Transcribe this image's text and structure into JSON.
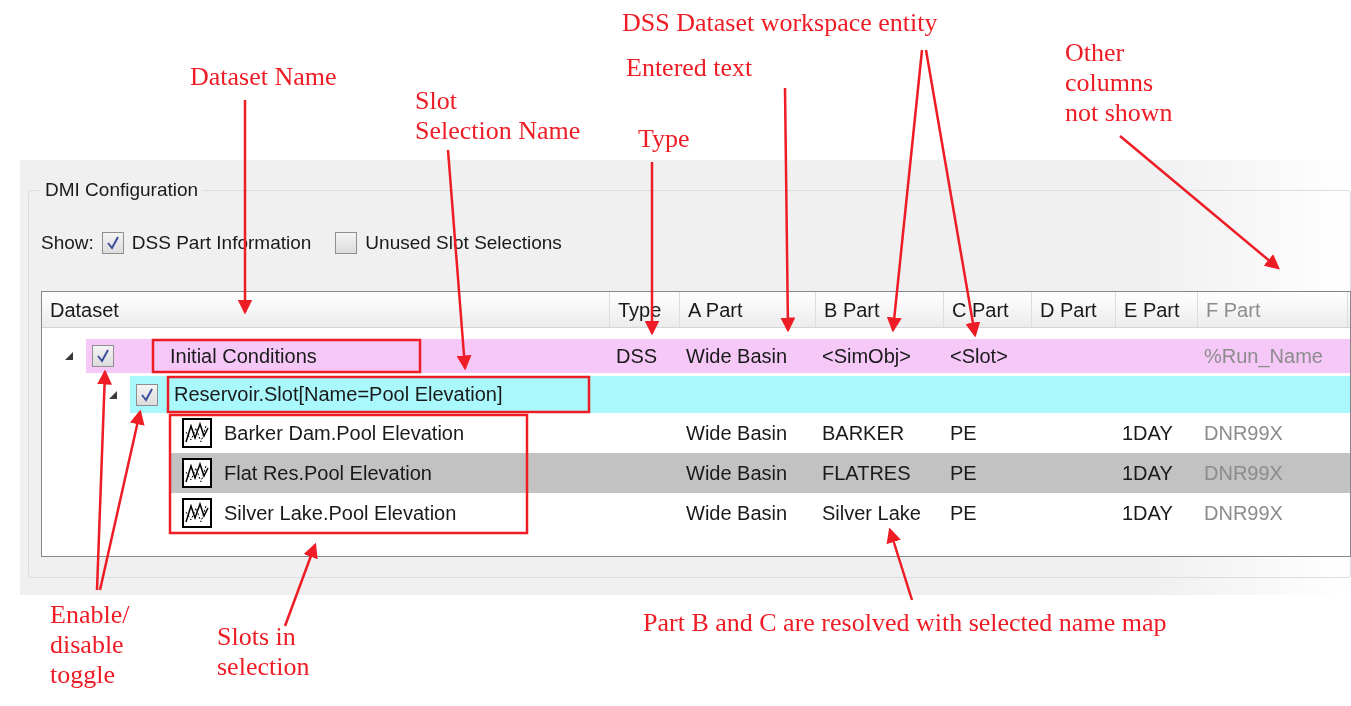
{
  "panel": {
    "title": "DMI Configuration",
    "show_label": "Show:",
    "options": [
      {
        "label": "DSS Part Information",
        "checked": true
      },
      {
        "label": "Unused Slot Selections",
        "checked": false
      }
    ]
  },
  "table": {
    "columns": [
      "Dataset",
      "Type",
      "A Part",
      "B Part",
      "C Part",
      "D Part",
      "E Part",
      "F Part"
    ],
    "rows": [
      {
        "kind": "dataset",
        "name": "Initial Conditions",
        "checked": true,
        "expanded": true,
        "cells": {
          "type": "DSS",
          "a_part": "Wide Basin",
          "b_part": "<SimObj>",
          "c_part": "<Slot>",
          "f_part": "%Run_Name"
        },
        "children": [
          {
            "kind": "selection",
            "name": "Reservoir.Slot[Name=Pool Elevation]",
            "checked": true,
            "expanded": true,
            "children": [
              {
                "kind": "slot",
                "name": "Barker Dam.Pool Elevation",
                "selected": false,
                "cells": {
                  "a_part": "Wide Basin",
                  "b_part": "BARKER",
                  "c_part": "PE",
                  "e_part": "1DAY",
                  "f_part": "DNR99X"
                }
              },
              {
                "kind": "slot",
                "name": "Flat Res.Pool Elevation",
                "selected": true,
                "cells": {
                  "a_part": "Wide Basin",
                  "b_part": "FLATRES",
                  "c_part": "PE",
                  "e_part": "1DAY",
                  "f_part": "DNR99X"
                }
              },
              {
                "kind": "slot",
                "name": "Silver Lake.Pool Elevation",
                "selected": false,
                "cells": {
                  "a_part": "Wide Basin",
                  "b_part": "Silver Lake",
                  "c_part": "PE",
                  "e_part": "1DAY",
                  "f_part": "DNR99X"
                }
              }
            ]
          }
        ]
      }
    ]
  },
  "annotations": [
    "DSS Dataset workspace entity",
    "Other\ncolumns\nnot shown",
    "Entered text",
    "Dataset Name",
    "Slot\nSelection Name",
    "Type",
    "Enable/\ndisable\ntoggle",
    "Slots in\nselection",
    "Part B and C are resolved with selected name map"
  ]
}
